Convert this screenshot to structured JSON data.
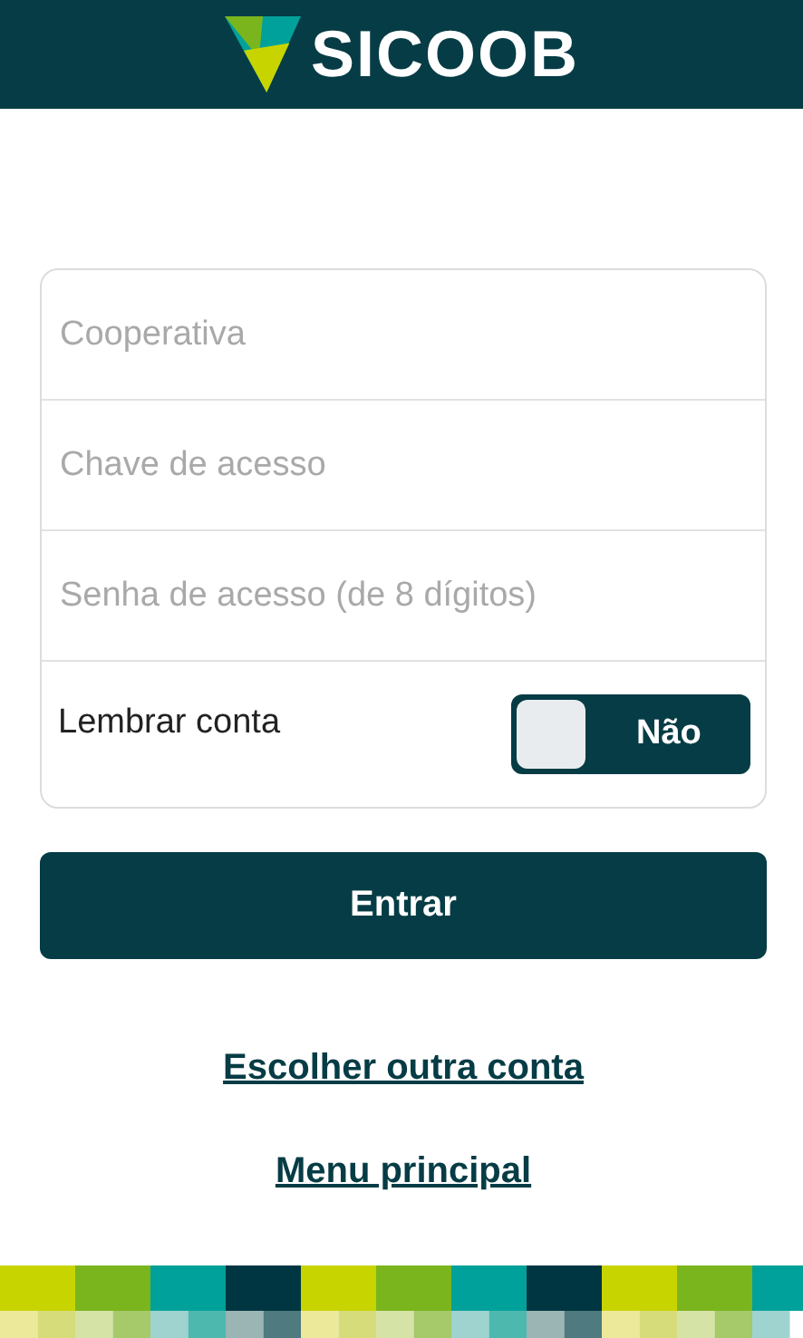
{
  "header": {
    "logo_text": "SICOOB"
  },
  "form": {
    "fields": [
      {
        "placeholder": "Cooperativa"
      },
      {
        "placeholder": "Chave de acesso"
      },
      {
        "placeholder": "Senha de acesso (de 8 dígitos)"
      }
    ],
    "remember": {
      "label": "Lembrar conta",
      "on": false,
      "state_text": "Não"
    }
  },
  "submit_button": "Entrar",
  "links": [
    "Escolher outra conta",
    "Menu principal"
  ]
}
